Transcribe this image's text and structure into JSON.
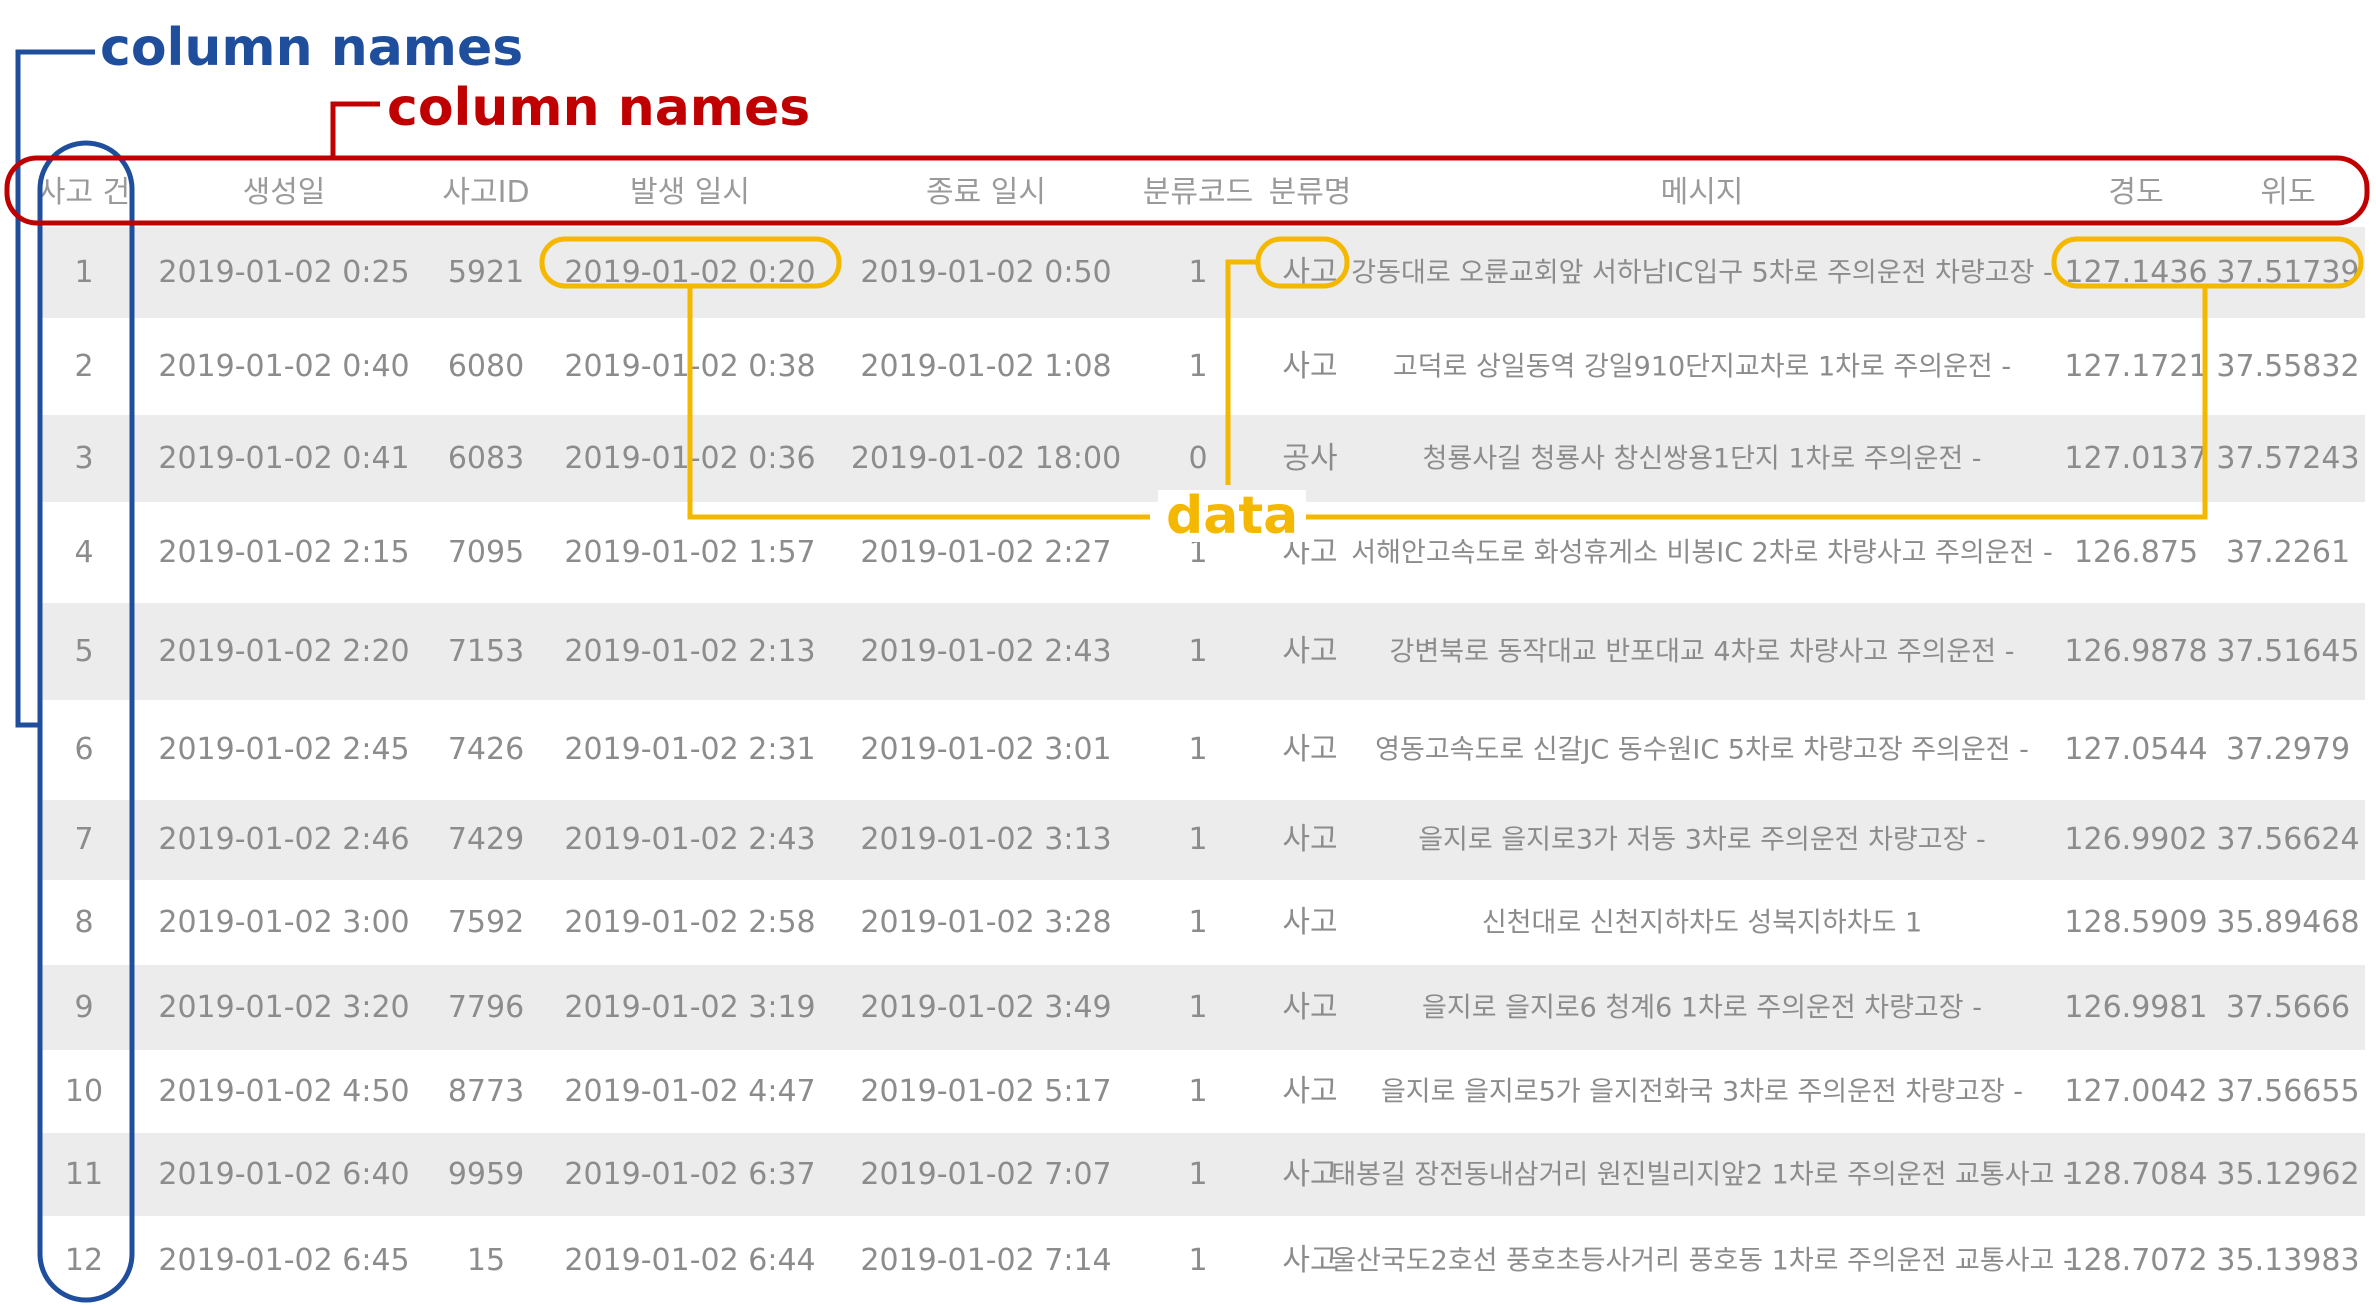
{
  "annotations": {
    "column_names_blue": "column names",
    "column_names_red": "column names",
    "data": "data",
    "colors": {
      "blue": "#1f4e9c",
      "red": "#c00000",
      "yellow": "#f5b800"
    }
  },
  "table": {
    "columns": [
      "사고 건",
      "생성일",
      "사고ID",
      "발생 일시",
      "종료 일시",
      "분류코드",
      "분류명",
      "메시지",
      "경도",
      "위도"
    ],
    "rows": [
      [
        "1",
        "2019-01-02 0:25",
        "5921",
        "2019-01-02 0:20",
        "2019-01-02 0:50",
        "1",
        "사고",
        "강동대로 오륜교회앞 서하남IC입구 5차로 주의운전 차량고장 -",
        "127.1436",
        "37.51739"
      ],
      [
        "2",
        "2019-01-02 0:40",
        "6080",
        "2019-01-02 0:38",
        "2019-01-02 1:08",
        "1",
        "사고",
        "고덕로 상일동역 강일910단지교차로 1차로 주의운전 -",
        "127.1721",
        "37.55832"
      ],
      [
        "3",
        "2019-01-02 0:41",
        "6083",
        "2019-01-02 0:36",
        "2019-01-02 18:00",
        "0",
        "공사",
        "청룡사길 청룡사 창신쌍용1단지 1차로 주의운전 -",
        "127.0137",
        "37.57243"
      ],
      [
        "4",
        "2019-01-02 2:15",
        "7095",
        "2019-01-02 1:57",
        "2019-01-02 2:27",
        "1",
        "사고",
        "서해안고속도로 화성휴게소 비봉IC 2차로 차량사고 주의운전 -",
        "126.875",
        "37.2261"
      ],
      [
        "5",
        "2019-01-02 2:20",
        "7153",
        "2019-01-02 2:13",
        "2019-01-02 2:43",
        "1",
        "사고",
        "강변북로 동작대교 반포대교 4차로 차량사고 주의운전 -",
        "126.9878",
        "37.51645"
      ],
      [
        "6",
        "2019-01-02 2:45",
        "7426",
        "2019-01-02 2:31",
        "2019-01-02 3:01",
        "1",
        "사고",
        "영동고속도로 신갈JC 동수원IC 5차로 차량고장 주의운전 -",
        "127.0544",
        "37.2979"
      ],
      [
        "7",
        "2019-01-02 2:46",
        "7429",
        "2019-01-02 2:43",
        "2019-01-02 3:13",
        "1",
        "사고",
        "을지로 을지로3가 저동 3차로 주의운전 차량고장 -",
        "126.9902",
        "37.56624"
      ],
      [
        "8",
        "2019-01-02 3:00",
        "7592",
        "2019-01-02 2:58",
        "2019-01-02 3:28",
        "1",
        "사고",
        "신천대로 신천지하차도 성북지하차도 1",
        "128.5909",
        "35.89468"
      ],
      [
        "9",
        "2019-01-02 3:20",
        "7796",
        "2019-01-02 3:19",
        "2019-01-02 3:49",
        "1",
        "사고",
        "을지로 을지로6 청계6 1차로 주의운전 차량고장 -",
        "126.9981",
        "37.5666"
      ],
      [
        "10",
        "2019-01-02 4:50",
        "8773",
        "2019-01-02 4:47",
        "2019-01-02 5:17",
        "1",
        "사고",
        "을지로 을지로5가 을지전화국 3차로 주의운전 차량고장 -",
        "127.0042",
        "37.56655"
      ],
      [
        "11",
        "2019-01-02 6:40",
        "9959",
        "2019-01-02 6:37",
        "2019-01-02 7:07",
        "1",
        "사고",
        "태봉길 장전동내삼거리 원진빌리지앞2 1차로 주의운전 교통사고 -",
        "128.7084",
        "35.12962"
      ],
      [
        "12",
        "2019-01-02 6:45",
        "15",
        "2019-01-02 6:44",
        "2019-01-02 7:14",
        "1",
        "사고",
        "울산국도2호선 풍호초등사거리 풍호동 1차로 주의운전 교통사고 -",
        "128.7072",
        "35.13983"
      ]
    ]
  }
}
